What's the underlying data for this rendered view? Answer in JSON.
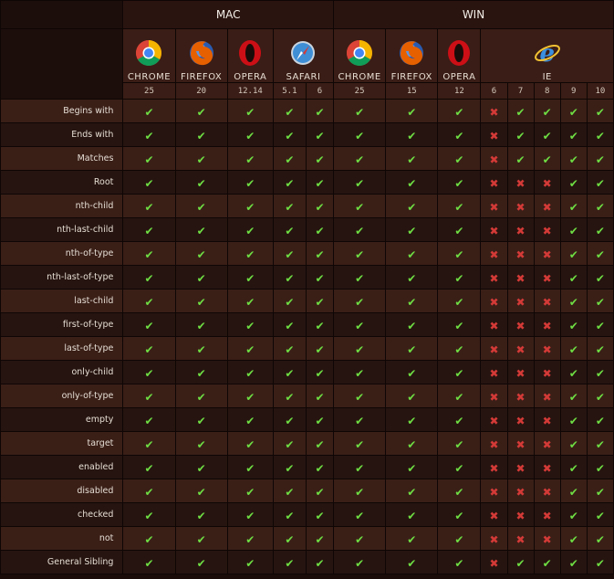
{
  "os": {
    "mac": "MAC",
    "win": "WIN"
  },
  "browsers": [
    {
      "label": "CHROME",
      "icon": "chrome-icon"
    },
    {
      "label": "FIREFOX",
      "icon": "firefox-icon"
    },
    {
      "label": "OPERA",
      "icon": "opera-icon"
    },
    {
      "label": "SAFARI",
      "icon": "safari-icon"
    },
    {
      "label": "CHROME",
      "icon": "chrome-icon"
    },
    {
      "label": "FIREFOX",
      "icon": "firefox-icon"
    },
    {
      "label": "OPERA",
      "icon": "opera-icon"
    },
    {
      "label": "IE",
      "icon": "ie-icon"
    }
  ],
  "versions": [
    "25",
    "20",
    "12.14",
    "5.1",
    "6",
    "25",
    "15",
    "12",
    "6",
    "7",
    "8",
    "9",
    "10"
  ],
  "features": [
    {
      "name": "Begins with",
      "support": [
        1,
        1,
        1,
        1,
        1,
        1,
        1,
        1,
        0,
        1,
        1,
        1,
        1
      ]
    },
    {
      "name": "Ends with",
      "support": [
        1,
        1,
        1,
        1,
        1,
        1,
        1,
        1,
        0,
        1,
        1,
        1,
        1
      ]
    },
    {
      "name": "Matches",
      "support": [
        1,
        1,
        1,
        1,
        1,
        1,
        1,
        1,
        0,
        1,
        1,
        1,
        1
      ]
    },
    {
      "name": "Root",
      "support": [
        1,
        1,
        1,
        1,
        1,
        1,
        1,
        1,
        0,
        0,
        0,
        1,
        1
      ]
    },
    {
      "name": "nth-child",
      "support": [
        1,
        1,
        1,
        1,
        1,
        1,
        1,
        1,
        0,
        0,
        0,
        1,
        1
      ]
    },
    {
      "name": "nth-last-child",
      "support": [
        1,
        1,
        1,
        1,
        1,
        1,
        1,
        1,
        0,
        0,
        0,
        1,
        1
      ]
    },
    {
      "name": "nth-of-type",
      "support": [
        1,
        1,
        1,
        1,
        1,
        1,
        1,
        1,
        0,
        0,
        0,
        1,
        1
      ]
    },
    {
      "name": "nth-last-of-type",
      "support": [
        1,
        1,
        1,
        1,
        1,
        1,
        1,
        1,
        0,
        0,
        0,
        1,
        1
      ]
    },
    {
      "name": "last-child",
      "support": [
        1,
        1,
        1,
        1,
        1,
        1,
        1,
        1,
        0,
        0,
        0,
        1,
        1
      ]
    },
    {
      "name": "first-of-type",
      "support": [
        1,
        1,
        1,
        1,
        1,
        1,
        1,
        1,
        0,
        0,
        0,
        1,
        1
      ]
    },
    {
      "name": "last-of-type",
      "support": [
        1,
        1,
        1,
        1,
        1,
        1,
        1,
        1,
        0,
        0,
        0,
        1,
        1
      ]
    },
    {
      "name": "only-child",
      "support": [
        1,
        1,
        1,
        1,
        1,
        1,
        1,
        1,
        0,
        0,
        0,
        1,
        1
      ]
    },
    {
      "name": "only-of-type",
      "support": [
        1,
        1,
        1,
        1,
        1,
        1,
        1,
        1,
        0,
        0,
        0,
        1,
        1
      ]
    },
    {
      "name": "empty",
      "support": [
        1,
        1,
        1,
        1,
        1,
        1,
        1,
        1,
        0,
        0,
        0,
        1,
        1
      ]
    },
    {
      "name": "target",
      "support": [
        1,
        1,
        1,
        1,
        1,
        1,
        1,
        1,
        0,
        0,
        0,
        1,
        1
      ]
    },
    {
      "name": "enabled",
      "support": [
        1,
        1,
        1,
        1,
        1,
        1,
        1,
        1,
        0,
        0,
        0,
        1,
        1
      ]
    },
    {
      "name": "disabled",
      "support": [
        1,
        1,
        1,
        1,
        1,
        1,
        1,
        1,
        0,
        0,
        0,
        1,
        1
      ]
    },
    {
      "name": "checked",
      "support": [
        1,
        1,
        1,
        1,
        1,
        1,
        1,
        1,
        0,
        0,
        0,
        1,
        1
      ]
    },
    {
      "name": "not",
      "support": [
        1,
        1,
        1,
        1,
        1,
        1,
        1,
        1,
        0,
        0,
        0,
        1,
        1
      ]
    },
    {
      "name": "General Sibling",
      "support": [
        1,
        1,
        1,
        1,
        1,
        1,
        1,
        1,
        0,
        1,
        1,
        1,
        1
      ]
    }
  ],
  "marks": {
    "yes": "✔",
    "no": "✖"
  },
  "colors": {
    "yes": "#6edd43",
    "no": "#d33a37",
    "row_odd": "#3a1f17",
    "row_even": "#261410"
  }
}
